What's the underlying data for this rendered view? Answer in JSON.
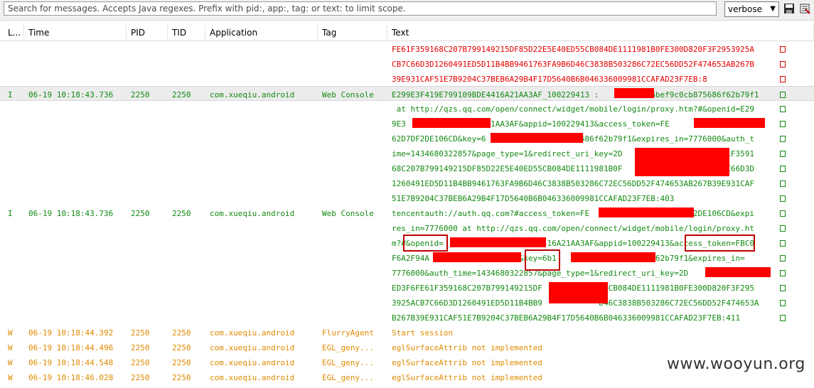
{
  "search": {
    "placeholder": "Search for messages. Accepts Java regexes. Prefix with pid:, app:, tag: or text: to limit scope."
  },
  "level_select": {
    "selected": "verbose"
  },
  "toolbar": {
    "save_icon": "save-icon",
    "clear_icon": "clear-log-icon"
  },
  "columns": [
    "L...",
    "Time",
    "PID",
    "TID",
    "Application",
    "Tag",
    "Text"
  ],
  "colors": {
    "error": "#e60000",
    "info": "#138a13",
    "warn": "#e08a00"
  },
  "rows": [
    {
      "level": "",
      "time": "",
      "pid": "",
      "tid": "",
      "app": "",
      "tag": "",
      "color": "#e60000",
      "lines": [
        "FE61F359168C207B799149215DF85D22E5E40ED55CB084DE1111981B0FE300D820F3F2953925A",
        "CB7C66D3D1260491ED5D11B4BB9461763FA9B6D46C3838B503286C72EC56DD52F474653AB267B",
        "39E931CAF51E7B9204C37BEB6A29B4F17D5640B6B046336009981CCAFAD23F7EB:8"
      ]
    },
    {
      "level": "I",
      "time": "06-19 10:18:43.736",
      "pid": "2250",
      "tid": "2250",
      "app": "com.xueqiu.android",
      "tag": "Web Console",
      "color": "#138a13",
      "selected": true,
      "lines": [
        "E299E3F419E799109BDE4416A21AA3AF_100229413 :          f6bef9c0cb875686f62b79f1"
      ]
    },
    {
      "level": "",
      "time": "",
      "pid": "",
      "tid": "",
      "app": "",
      "tag": "",
      "color": "#138a13",
      "lines": [
        " at http://qzs.qq.com/open/connect/widget/mobile/login/proxy.htm?#&openid=E29",
        "9E3               6A21AA3AF&appid=100229413&access_token=FE              F2",
        "62D7DF2DE106CD&key=6                  75686f62b79f1&expires_in=7776000&auth_t",
        "ime=1434680322857&page_type=1&redirect_uri_key=2D                   FE61F3591",
        "68C207B799149215DF85D22E5E40ED55CB084DE1111981B0F                   CB7C66D3D",
        "1260491ED5D11B4BB9461763FA9B6D46C3838B503286C72EC56DD52F474653AB267B39E931CAF",
        "51E7B9204C37BEB6A29B4F17D5640B6B046336009981CCAFAD23F7EB:403"
      ]
    },
    {
      "level": "I",
      "time": "06-19 10:18:43.736",
      "pid": "2250",
      "tid": "2250",
      "app": "com.xueqiu.android",
      "tag": "Web Console",
      "color": "#138a13",
      "lines": [
        "tencentauth://auth.qq.com?#access_token=FE                  07DF2DE106CD&expi",
        "res_in=7776000 at http://qzs.qq.com/open/connect/widget/mobile/login/proxy.ht",
        "m?#&openid=                    4416A21AA3AF&appid=100229413&access_token=FBC0",
        "F6A2F94A                 CD&key=6b1                5686f62b79f1&expires_in=",
        "7776000&auth_time=1434680322857&page_type=1&redirect_uri_key=2D             1",
        "ED3F6FE61F359168C207B799149215DF           D55CB084DE1111981B0FE300D820F3F295",
        "3925ACB7C66D3D1260491ED5D11B4BB9            D46C3838B503286C72EC56DD52F474653A",
        "B267B39E931CAF51E7B9204C37BEB6A29B4F17D5640B6B046336009981CCAFAD23F7EB:411"
      ]
    },
    {
      "level": "W",
      "time": "06-19 10:18:44.392",
      "pid": "2250",
      "tid": "2250",
      "app": "com.xueqiu.android",
      "tag": "FlurryAgent",
      "color": "#e08a00",
      "lines": [
        "Start session"
      ]
    },
    {
      "level": "W",
      "time": "06-19 10:18:44.496",
      "pid": "2250",
      "tid": "2250",
      "app": "com.xueqiu.android",
      "tag": "EGL_geny...",
      "color": "#e08a00",
      "lines": [
        "eglSurfaceAttrib not implemented"
      ]
    },
    {
      "level": "W",
      "time": "06-19 10:18:44.548",
      "pid": "2250",
      "tid": "2250",
      "app": "com.xueqiu.android",
      "tag": "EGL_geny...",
      "color": "#e08a00",
      "lines": [
        "eglSurfaceAttrib not implemented"
      ]
    },
    {
      "level": "W",
      "time": "06-19 10:18:46.028",
      "pid": "2250",
      "tid": "2250",
      "app": "com.xueqiu.android",
      "tag": "EGL_geny...",
      "color": "#e08a00",
      "lines": [
        "eglSurfaceAttrib not implemented"
      ]
    }
  ],
  "watermark": "www.wooyun.org"
}
